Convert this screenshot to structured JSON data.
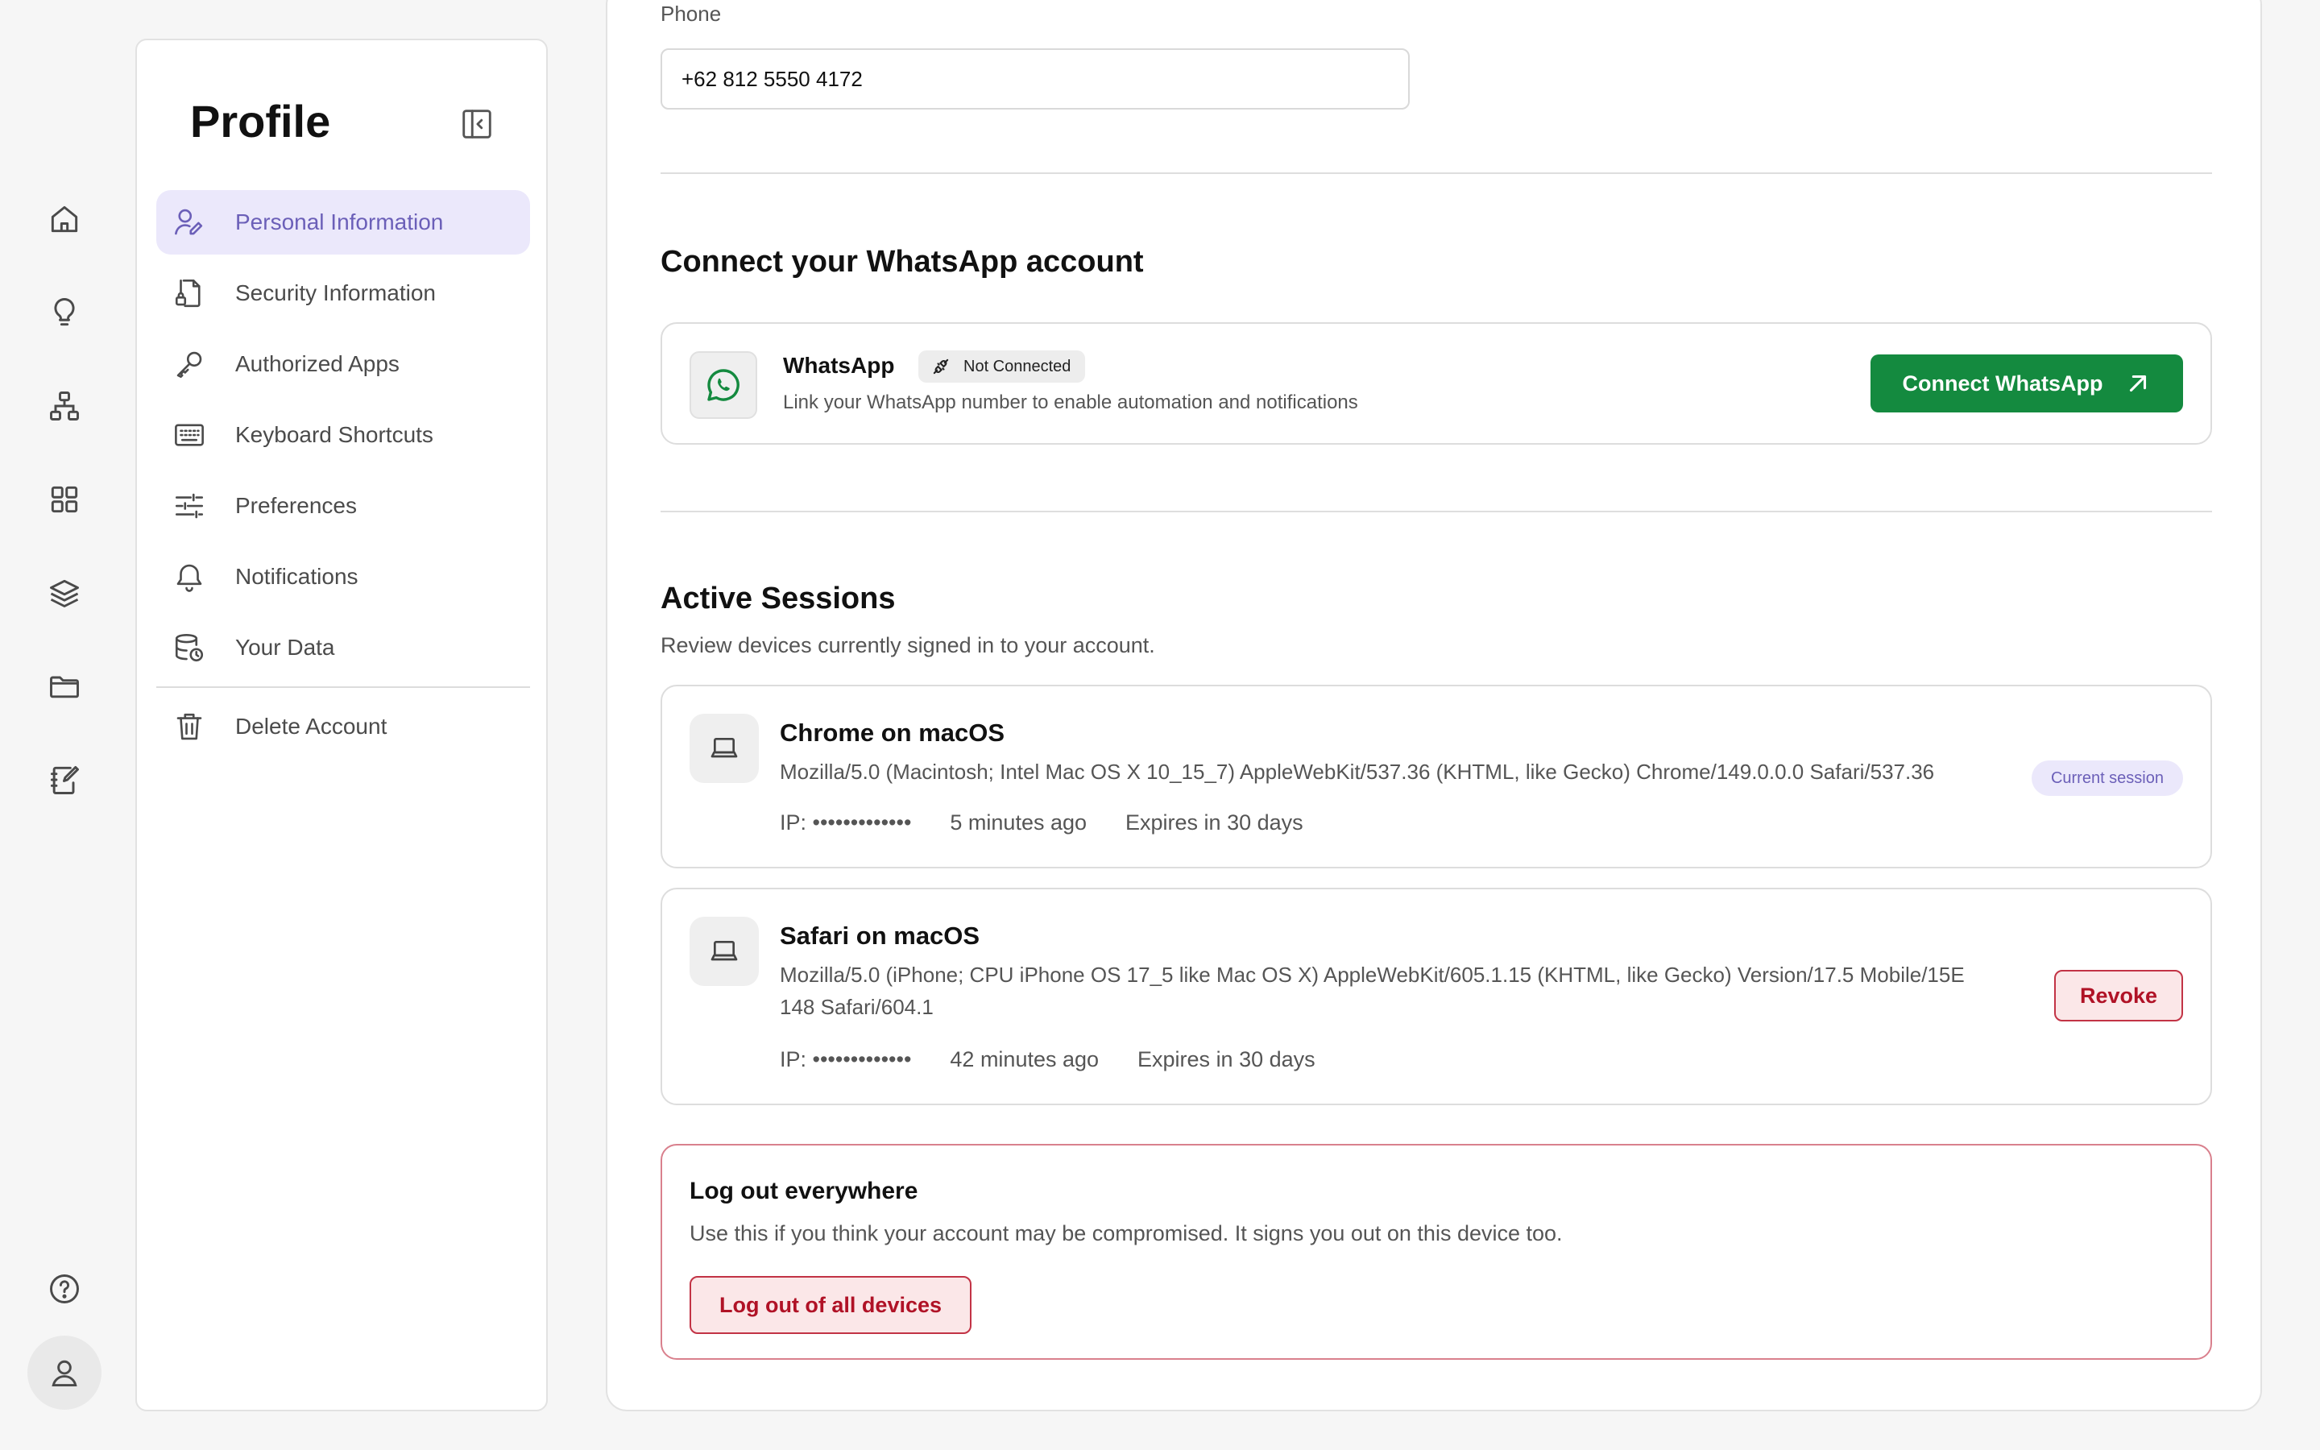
{
  "rail": {
    "icons": [
      "home-icon",
      "lightbulb-icon",
      "hierarchy-icon",
      "grid-icon",
      "layers-icon",
      "folder-icon",
      "notebook-edit-icon",
      "help-icon",
      "user-icon"
    ]
  },
  "nav": {
    "title": "Profile",
    "items": [
      {
        "label": "Personal Information",
        "icon": "user-edit-icon",
        "active": true
      },
      {
        "label": "Security Information",
        "icon": "file-lock-icon"
      },
      {
        "label": "Authorized Apps",
        "icon": "key-icon"
      },
      {
        "label": "Keyboard Shortcuts",
        "icon": "keyboard-icon"
      },
      {
        "label": "Preferences",
        "icon": "sliders-icon"
      },
      {
        "label": "Notifications",
        "icon": "bell-icon"
      },
      {
        "label": "Your Data",
        "icon": "database-icon"
      }
    ],
    "delete_label": "Delete Account"
  },
  "phone": {
    "label": "Phone",
    "value": "+62 812 5550 4172"
  },
  "whatsapp": {
    "section_title": "Connect your WhatsApp account",
    "name": "WhatsApp",
    "status": "Not Connected",
    "description": "Link your WhatsApp number to enable automation and notifications",
    "button_label": "Connect WhatsApp",
    "accent": "#148a3f"
  },
  "sessions": {
    "title": "Active Sessions",
    "subtitle": "Review devices currently signed in to your account.",
    "items": [
      {
        "title": "Chrome on macOS",
        "ua": "Mozilla/5.0 (Macintosh; Intel Mac OS X 10_15_7) AppleWebKit/537.36 (KHTML, like Gecko) Chrome/149.0.0.0 Safari/537.36",
        "ip": "IP: •••••••••••••",
        "last_active": "5 minutes ago",
        "expires": "Expires in 30 days",
        "badge": "Current session"
      },
      {
        "title": "Safari on macOS",
        "ua_line1": "Mozilla/5.0 (iPhone; CPU iPhone OS 17_5 like Mac OS X) AppleWebKit/605.1.15 (KHTML, like Gecko) Version/17.5 Mobile/15E",
        "ua_line2": "148 Safari/604.1",
        "ip": "IP: •••••••••••••",
        "last_active": "42 minutes ago",
        "expires": "Expires in 30 days",
        "action_label": "Revoke"
      }
    ]
  },
  "logout_all": {
    "title": "Log out everywhere",
    "description": "Use this if you think your account may be compromised. It signs you out on this device too.",
    "button_label": "Log out of all devices",
    "danger_color": "#b01226"
  }
}
